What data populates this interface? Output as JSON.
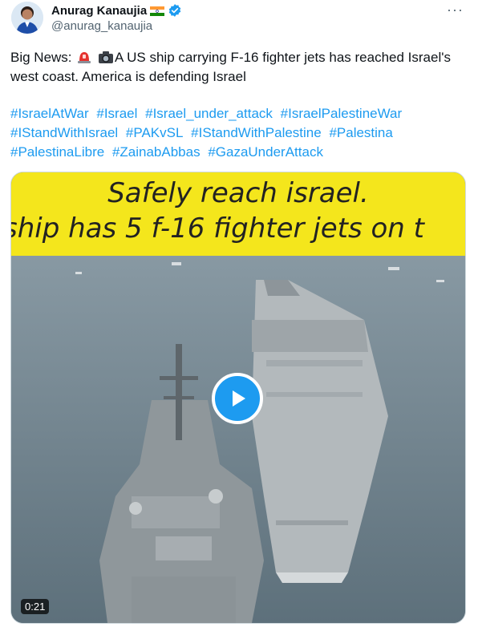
{
  "author": {
    "display_name": "Anurag Kanaujia",
    "handle": "@anurag_kanaujia",
    "flag_icon": "india-flag-icon",
    "verified_icon": "verified-badge-icon"
  },
  "more_label": "···",
  "tweet": {
    "text_prefix": "Big News:",
    "text_body": "A US ship carrying F-16 fighter jets has reached Israel's west coast. America is defending Israel",
    "emoji_1": "police-light-emoji",
    "emoji_2": "camera-emoji",
    "hashtags": [
      "#IsraelAtWar",
      "#Israel",
      "#Israel_under_attack",
      "#IsraelPalestineWar",
      "#IStandWithIsrael",
      "#PAKvSL",
      "#IStandWithPalestine",
      "#Palestina",
      "#PalestinaLibre",
      "#ZainabAbbas",
      "#GazaUnderAttack"
    ]
  },
  "media": {
    "caption_line_1": "Safely reach israel.",
    "caption_line_2": "ship has 5 f-16 fighter jets on t",
    "duration": "0:21",
    "play_icon": "play-icon"
  },
  "colors": {
    "link": "#1d9bf0",
    "verified": "#1d9bf0",
    "caption_band": "#f4e61c"
  }
}
